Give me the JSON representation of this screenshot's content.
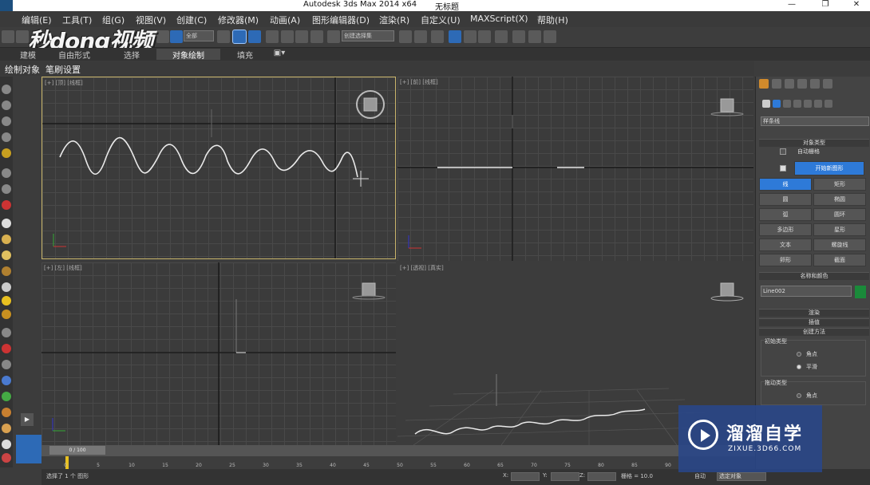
{
  "window": {
    "title": "Autodesk 3ds Max  2014 x64",
    "subtitle": "无标题",
    "min": "—",
    "max": "❐",
    "close": "✕"
  },
  "menu": [
    "编辑(E)",
    "工具(T)",
    "组(G)",
    "视图(V)",
    "创建(C)",
    "修改器(M)",
    "动画(A)",
    "图形编辑器(D)",
    "渲染(R)",
    "自定义(U)",
    "MAXScript(X)",
    "帮助(H)"
  ],
  "toolbar": {
    "selection_filter": "全部",
    "named_selection": "创建选择集"
  },
  "watermark_logo": "秒dong视频",
  "ribbon": {
    "tabs": [
      "建模",
      "自由形式",
      "选择",
      "对象绘制",
      "填充"
    ],
    "active": "对象绘制"
  },
  "subribbon": {
    "items": [
      "绘制对象",
      "笔刷设置"
    ]
  },
  "viewports": [
    {
      "label": "[+] [顶] [线框]"
    },
    {
      "label": "[+] [前] [线框]"
    },
    {
      "label": "[+] [左] [线框]"
    },
    {
      "label": "[+] [透视] [真实]"
    }
  ],
  "command_panel": {
    "category_dropdown": "样条线",
    "object_type_header": "对象类型",
    "autogrid": "自动栅格",
    "start_new_shape": "开始新图形",
    "buttons": [
      "线",
      "矩形",
      "圆",
      "椭圆",
      "弧",
      "圆环",
      "多边形",
      "星形",
      "文本",
      "螺旋线",
      "卵形",
      "截面"
    ],
    "active_button": "线",
    "name_color_header": "名称和颜色",
    "object_name": "Line002",
    "object_color": "#1a8a3a",
    "render_header": "渲染",
    "interp_header": "插值",
    "creation_method_header": "创建方法",
    "initial_type_label": "初始类型",
    "initial_options": [
      "角点",
      "平滑"
    ],
    "initial_selected": "平滑",
    "drag_type_label": "拖动类型",
    "drag_options": [
      "角点"
    ]
  },
  "timeline": {
    "frame": "0 / 100",
    "ticks": [
      "0",
      "5",
      "10",
      "15",
      "20",
      "25",
      "30",
      "35",
      "40",
      "45",
      "50",
      "55",
      "60",
      "65",
      "70",
      "75",
      "80",
      "85",
      "90"
    ]
  },
  "status": {
    "message": "选择了 1 个 图形",
    "x_label": "X:",
    "y_label": "Y:",
    "z_label": "Z:",
    "grid": "栅格 = 10.0",
    "auto": "自动",
    "selection_set": "选定对象"
  },
  "overlay": {
    "brand": "溜溜自学",
    "url": "ZIXUE.3D66.COM"
  },
  "colors": {
    "accent": "#2e7ad8",
    "active_viewport": "#c8b46a",
    "spline": "#e6e6e6"
  }
}
